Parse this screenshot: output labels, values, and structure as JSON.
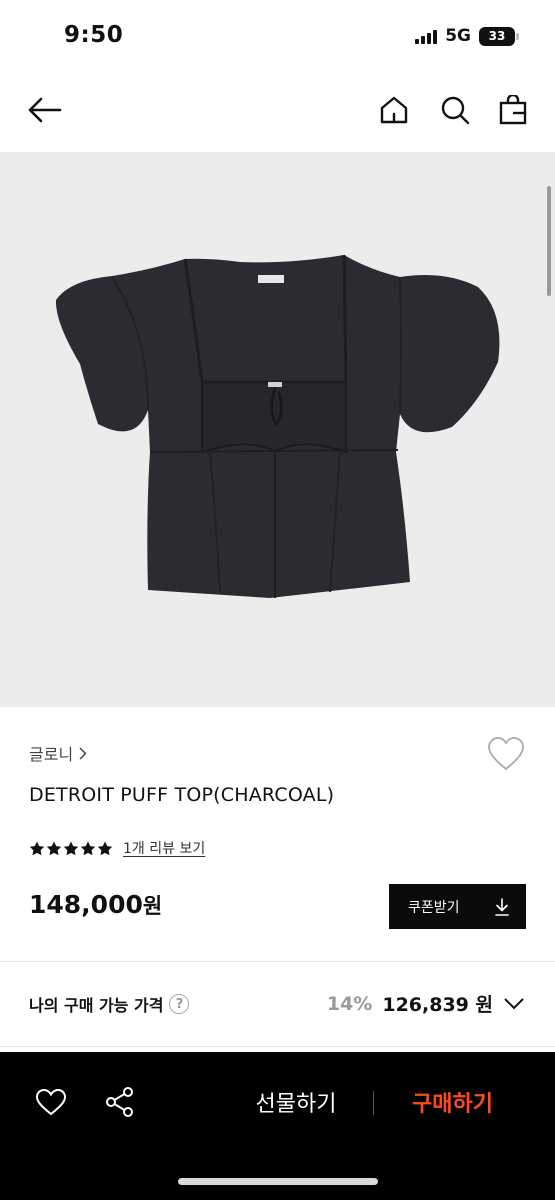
{
  "status_bar": {
    "time": "9:50",
    "network": "5G",
    "battery": "33"
  },
  "product": {
    "brand": "글로니",
    "name": "DETROIT PUFF TOP(CHARCOAL)",
    "rating_stars": 5,
    "review_link": "1개 리뷰 보기",
    "price": "148,000",
    "currency": "원",
    "coupon_label": "쿠폰받기"
  },
  "my_price": {
    "label": "나의 구매 가능 가격",
    "discount": "14%",
    "amount": "126,839",
    "currency": "원"
  },
  "bottom_bar": {
    "gift_label": "선물하기",
    "buy_label": "구매하기"
  },
  "colors": {
    "buy_accent": "#ff4b1c",
    "garment": "#2a2c31",
    "image_bg": "#ececec"
  }
}
